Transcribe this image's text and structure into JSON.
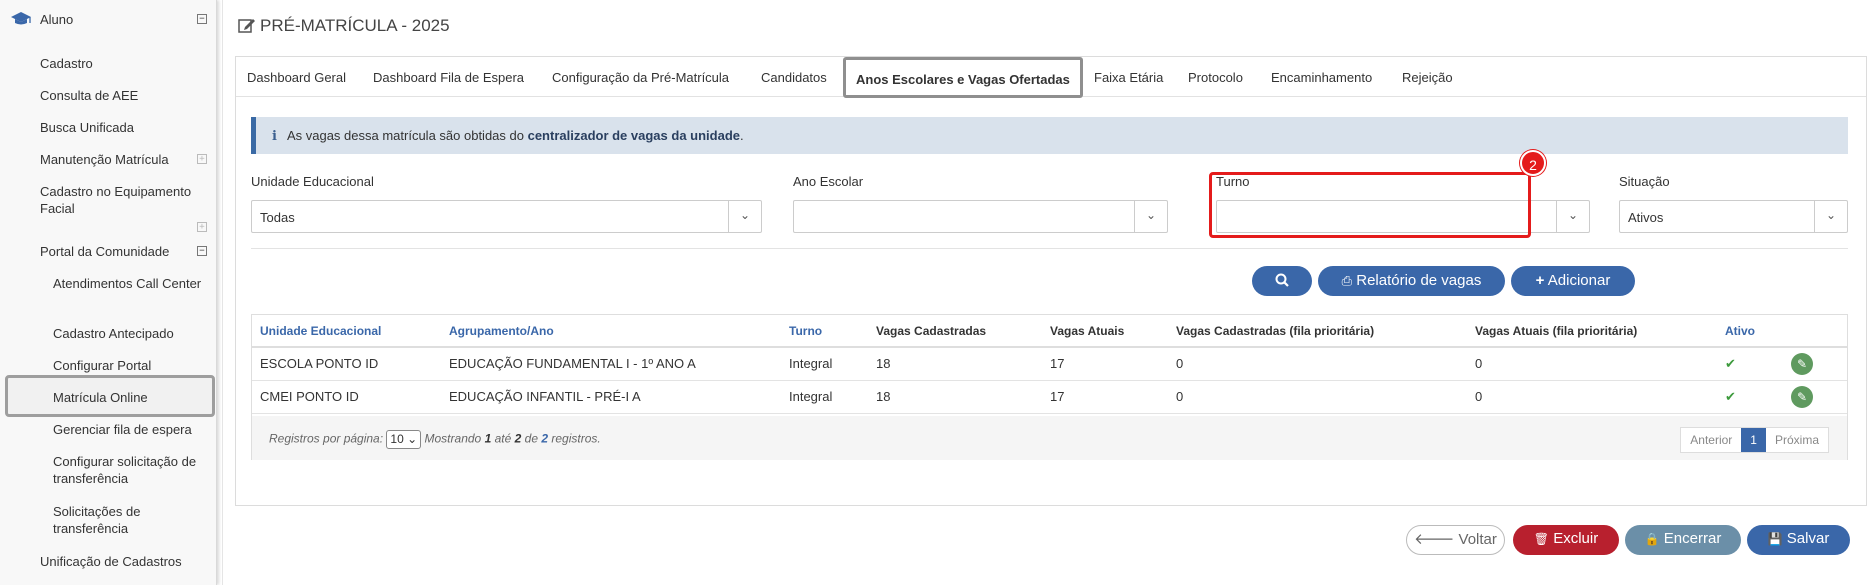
{
  "sidebar": {
    "header": "Aluno",
    "items": {
      "cadastro": "Cadastro",
      "consulta_aee": "Consulta de AEE",
      "busca_unificada": "Busca Unificada",
      "manutencao_matricula": "Manutenção Matrícula",
      "cadastro_equipamento": "Cadastro no Equipamento Facial",
      "portal_comunidade": "Portal da Comunidade",
      "unificacao_cadastros": "Unificação de Cadastros"
    },
    "sub_items": {
      "atendimentos": "Atendimentos Call Center",
      "cadastro_antecipado": "Cadastro Antecipado",
      "configurar_portal": "Configurar Portal",
      "matricula_online": "Matrícula Online",
      "gerenciar_fila": "Gerenciar fila de espera",
      "configurar_transferencia": "Configurar solicitação de transferência",
      "solicitacoes_transferencia": "Solicitações de transferência"
    }
  },
  "page": {
    "title": "PRÉ-MATRÍCULA - 2025"
  },
  "tabs": {
    "dashboard_geral": "Dashboard Geral",
    "dashboard_fila": "Dashboard Fila de Espera",
    "configuracao": "Configuração da Pré-Matrícula",
    "candidatos": "Candidatos",
    "anos_escolares": "Anos Escolares e Vagas Ofertadas",
    "faixa_etaria": "Faixa Etária",
    "protocolo": "Protocolo",
    "encaminhamento": "Encaminhamento",
    "rejeicao": "Rejeição"
  },
  "info": {
    "prefix": "As vagas dessa matrícula são obtidas do ",
    "bold": "centralizador de vagas da unidade",
    "suffix": "."
  },
  "filters": {
    "unidade": {
      "label": "Unidade Educacional",
      "value": "Todas"
    },
    "ano": {
      "label": "Ano Escolar",
      "value": ""
    },
    "turno": {
      "label": "Turno",
      "value": ""
    },
    "situacao": {
      "label": "Situação",
      "value": "Ativos"
    }
  },
  "annotation_badge": "2",
  "actions": {
    "relatorio": "Relatório de vagas",
    "adicionar": "Adicionar"
  },
  "table": {
    "headers": {
      "unidade": "Unidade Educacional",
      "agrupamento": "Agrupamento/Ano",
      "turno": "Turno",
      "vagas_cad": "Vagas Cadastradas",
      "vagas_atuais": "Vagas Atuais",
      "vagas_cad_fila": "Vagas Cadastradas (fila prioritária)",
      "vagas_atuais_fila": "Vagas Atuais (fila prioritária)",
      "ativo": "Ativo"
    },
    "rows": [
      {
        "unidade": "ESCOLA PONTO ID",
        "agrupamento": "EDUCAÇÃO FUNDAMENTAL I - 1º ANO A",
        "turno": "Integral",
        "vagas_cad": "18",
        "vagas_atuais": "17",
        "vagas_cad_fila": "0",
        "vagas_atuais_fila": "0"
      },
      {
        "unidade": "CMEI PONTO ID",
        "agrupamento": "EDUCAÇÃO INFANTIL - PRÉ-I A",
        "turno": "Integral",
        "vagas_cad": "18",
        "vagas_atuais": "17",
        "vagas_cad_fila": "0",
        "vagas_atuais_fila": "0"
      }
    ],
    "footer": {
      "per_page_label": "Registros por página:",
      "per_page_value": "10",
      "mostrando": "Mostrando",
      "from": "1",
      "ate": "até",
      "to": "2",
      "de": "de",
      "total": "2",
      "registros": "registros."
    },
    "pager": {
      "prev": "Anterior",
      "current": "1",
      "next": "Próxima"
    }
  },
  "bottom_buttons": {
    "voltar": "Voltar",
    "excluir": "Excluir",
    "encerrar": "Encerrar",
    "salvar": "Salvar"
  },
  "colors": {
    "primary": "#3a67a9",
    "danger": "#b8202e",
    "muted": "#6b8fa8",
    "highlight": "#e41b1b",
    "success": "#3c9a3c"
  }
}
